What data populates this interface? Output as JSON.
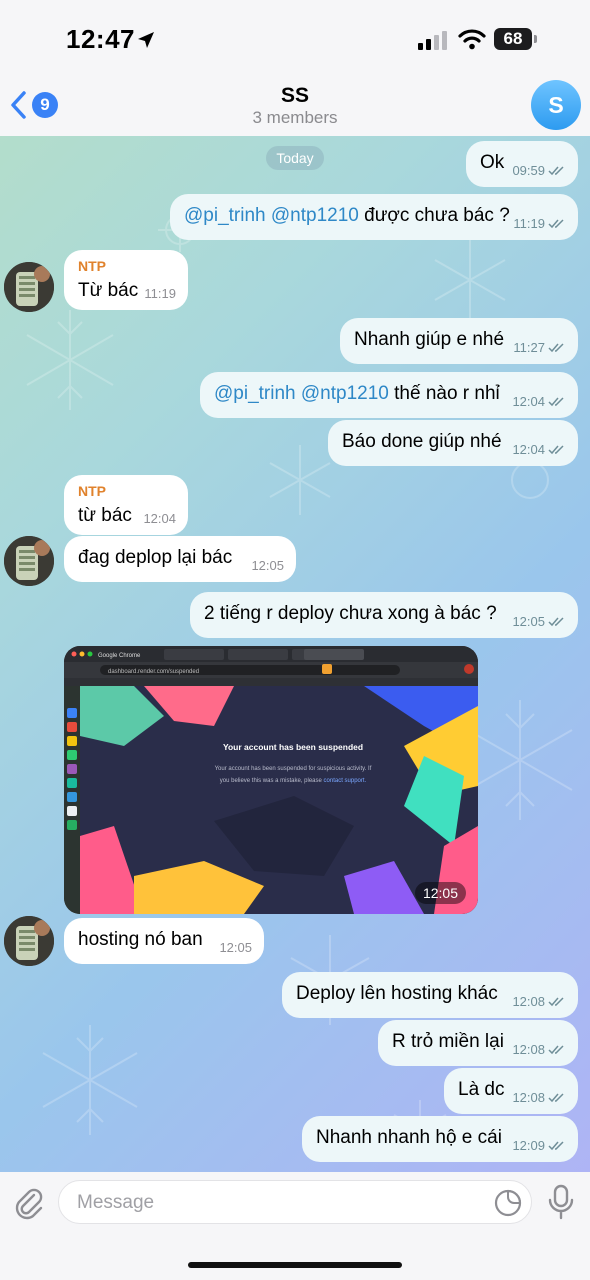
{
  "status_bar": {
    "time": "12:47",
    "battery": "68"
  },
  "header": {
    "back_count": "9",
    "title": "SS",
    "subtitle": "3 members",
    "avatar_letter": "S"
  },
  "date_label": "Today",
  "messages": [
    {
      "text": "Ok",
      "time": "09:59"
    },
    {
      "mention1": "@pi_trinh",
      "mention2": "@ntp1210",
      "text": " được chưa bác ?",
      "time": "11:19"
    },
    {
      "sender": "NTP",
      "text": "Từ bác",
      "time": "11:19"
    },
    {
      "text": "Nhanh giúp e nhé",
      "time": "11:27"
    },
    {
      "mention1": "@pi_trinh",
      "mention2": "@ntp1210",
      "text": " thế nào r nhỉ",
      "time": "12:04"
    },
    {
      "text": "Báo done giúp nhé",
      "time": "12:04"
    },
    {
      "sender": "NTP",
      "text": "từ bác",
      "time": "12:04"
    },
    {
      "text": "đag deplop lại bác",
      "time": "12:05"
    },
    {
      "text": "2 tiếng r deploy chưa xong à bác ?",
      "time": "12:05"
    },
    {
      "text": "hosting nó ban",
      "time": "12:05"
    },
    {
      "text": "Deploy lên hosting khác",
      "time": "12:08"
    },
    {
      "text": "R trỏ miền lại",
      "time": "12:08"
    },
    {
      "text": "Là dc",
      "time": "12:08"
    },
    {
      "text": "Nhanh nhanh hộ e cái",
      "time": "12:09"
    }
  ],
  "screenshot_photo": {
    "time": "12:05",
    "app_name": "Google Chrome",
    "url": "dashboard.render.com/suspended",
    "heading": "Your account has been suspended",
    "body_line1": "Your account has been suspended for suspicious activity. If",
    "body_line2": "you believe this was a mistake, please ",
    "link": "contact support."
  },
  "composer": {
    "placeholder": "Message"
  },
  "colors": {
    "accent": "#3a82f6",
    "sender_name": "#e0822c",
    "mention": "#2e88c7"
  }
}
